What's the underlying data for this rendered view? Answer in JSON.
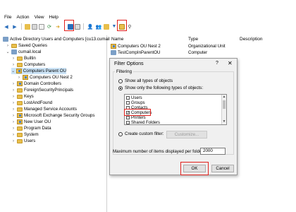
{
  "menu": [
    "File",
    "Action",
    "View",
    "Help"
  ],
  "toolbar": {
    "icons": [
      "back-arrow-icon",
      "forward-arrow-icon",
      "folder-up-icon",
      "details-icon",
      "copy-icon",
      "refresh-icon",
      "export-icon",
      "new-folder-icon",
      "help-icon",
      "view-icon",
      "user-icon",
      "group-icon",
      "filter-icon",
      "ou-icon",
      "find-icon"
    ]
  },
  "tree": {
    "root": "Active Directory Users and Computers [cu13.cumail",
    "saved_queries": "Saved Queries",
    "domain": "cumail.local",
    "items": [
      "Builtin",
      "Computers",
      "Computers Parent OU",
      "Computers OU Nest 2",
      "Domain Controllers",
      "ForeignSecurityPrincipals",
      "Keys",
      "LostAndFound",
      "Managed Service Accounts",
      "Microsoft Exchange Security Groups",
      "New User OU",
      "Program Data",
      "System",
      "Users"
    ]
  },
  "list": {
    "headers": {
      "name": "Name",
      "type": "Type",
      "description": "Description"
    },
    "rows": [
      {
        "name": "Computers OU Nest 2",
        "type": "Organizational Unit"
      },
      {
        "name": "TestCompInParentOU",
        "type": "Computer"
      }
    ]
  },
  "dialog": {
    "title": "Filter Options",
    "help": "?",
    "close": "✕",
    "filtering_label": "Filtering",
    "show_all": "Show all types of objects",
    "show_only": "Show only the following types of objects:",
    "object_types": [
      {
        "label": "Users",
        "checked": false
      },
      {
        "label": "Groups",
        "checked": false
      },
      {
        "label": "Contacts",
        "checked": false
      },
      {
        "label": "Computers",
        "checked": true
      },
      {
        "label": "Printers",
        "checked": false
      },
      {
        "label": "Shared Folders",
        "checked": false
      }
    ],
    "custom_filter": "Create custom filter:",
    "customize": "Customize...",
    "max_items_label": "Maximum number of items displayed per folder:",
    "max_items_value": "2000",
    "ok": "OK",
    "cancel": "Cancel"
  },
  "colors": {
    "highlight": "#e0201c",
    "selection": "#cce4f7",
    "folder": "#e8bf4c"
  }
}
